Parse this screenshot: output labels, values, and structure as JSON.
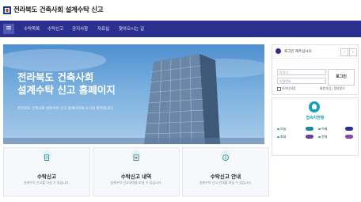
{
  "header": {
    "site_title": "전라북도 건축사회 설계수탁 신고"
  },
  "nav": {
    "items": [
      "수탁목록",
      "수탁신고",
      "공지사항",
      "자료실",
      "찾아오시는 길"
    ],
    "accent": "#2b2f8f"
  },
  "hero": {
    "title_line1": "전라북도 건축사회",
    "title_line2": "설계수탁 신고 홈페이지",
    "subtitle": "전라북도 건축사회 설계수탁 신고 홈페이지에 오신걸 환영합니다."
  },
  "cards": [
    {
      "icon": "document-icon",
      "title": "수탁신고",
      "desc": "설계수탁 신고를 하실 수 있습니다."
    },
    {
      "icon": "list-icon",
      "title": "수탁신고 내역",
      "desc": "설계수탁 신고내역을 보실 수 있습니다."
    },
    {
      "icon": "info-icon",
      "title": "수탁신고 안내",
      "desc": "설계수탁 신고 안내를 보실 수 있습니다."
    }
  ],
  "login": {
    "header_text": "로그인 해주십시오.",
    "id_placeholder": "아이디",
    "pw_placeholder": "비밀번호",
    "button_label": "로그인",
    "save_id_label": "아이디저장",
    "find_links": "회원가입 | 정보찾기"
  },
  "visitors": {
    "title": "접속자현황",
    "stats": [
      {
        "label": "오늘",
        "value": ""
      },
      {
        "label": "어제",
        "value": ""
      },
      {
        "label": "최대",
        "value": ""
      },
      {
        "label": "전체",
        "value": ""
      }
    ]
  }
}
